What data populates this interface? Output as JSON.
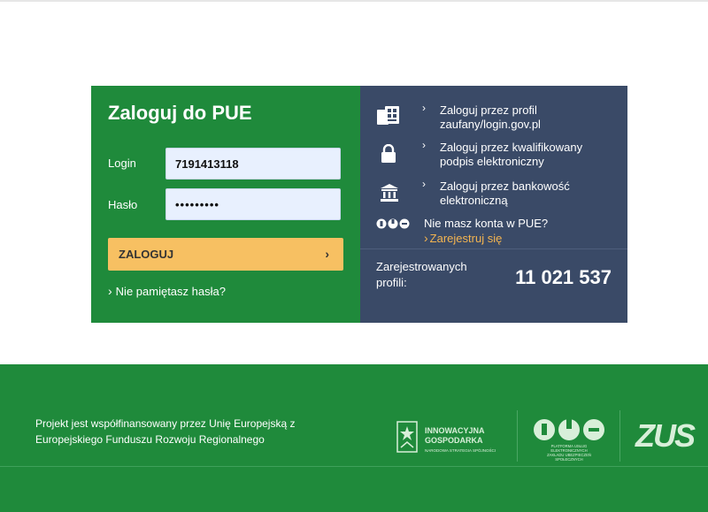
{
  "login": {
    "title": "Zaloguj do PUE",
    "login_label": "Login",
    "login_value": "7191413118",
    "password_label": "Hasło",
    "password_value": "•••••••••",
    "submit_label": "ZALOGUJ",
    "forgot_label": "Nie pamiętasz hasła?"
  },
  "alt": {
    "profile_line1": "Zaloguj przez profil",
    "profile_line2": "zaufany/login.gov.pl",
    "signature_line1": "Zaloguj przez kwalifikowany",
    "signature_line2": "podpis elektroniczny",
    "bank_line1": "Zaloguj przez bankowość",
    "bank_line2": "elektroniczną",
    "no_account": "Nie masz konta w PUE?",
    "register": "Zarejestruj się",
    "registered_line1": "Zarejestrowanych",
    "registered_line2": "profili:",
    "registered_count": "11 021 537"
  },
  "footer": {
    "text_line1": "Projekt jest współfinansowany przez Unię Europejską z",
    "text_line2": "Europejskiego Funduszu Rozwoju Regionalnego",
    "ig_line1": "INNOWACYJNA",
    "ig_line2": "GOSPODARKA",
    "ig_line3": "NARODOWA STRATEGIA SPÓJNOŚCI",
    "pue_logo_text": "PUE",
    "pue_sub1": "PLATFORMA USŁUG ELEKTRONICZNYCH",
    "pue_sub2": "ZAKŁADU UBEZPIECZEŃ SPOŁECZNYCH",
    "zus_logo_text": "ZUS"
  },
  "colors": {
    "green": "#1f8a3b",
    "navy": "#3a4a67",
    "button": "#f7c062",
    "link": "#f3b450"
  },
  "icons": [
    "id-card-icon",
    "lock-icon",
    "bank-icon",
    "pue-logo-icon",
    "chevron-right-icon"
  ]
}
